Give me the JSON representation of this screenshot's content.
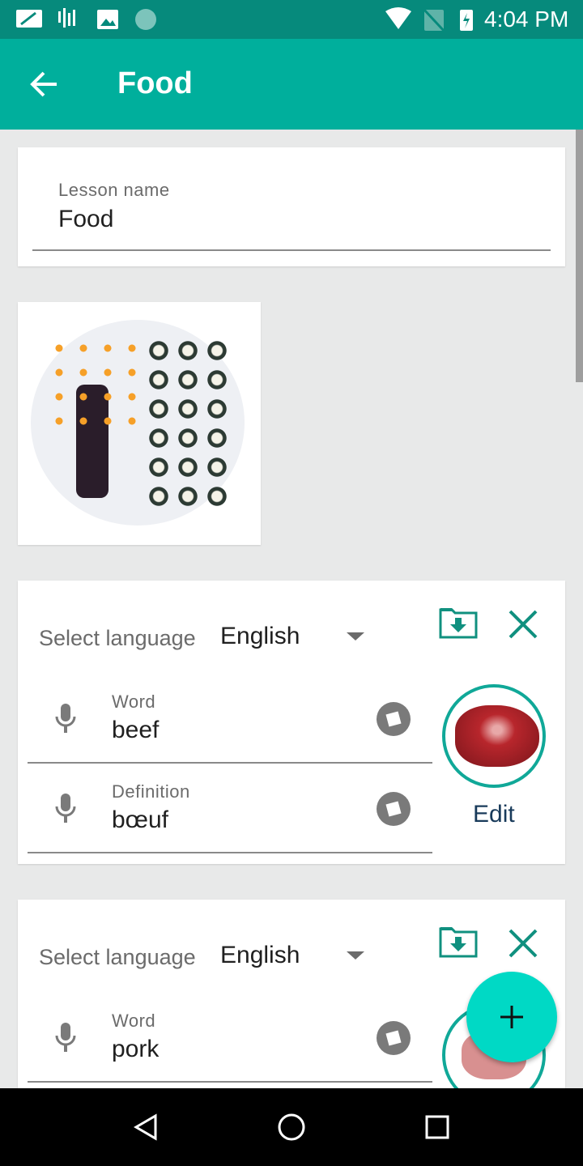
{
  "status_bar": {
    "time": "4:04 PM",
    "icons": [
      "sim-card-icon",
      "voicemail-icon",
      "image-icon",
      "sync-icon",
      "wifi-icon",
      "no-sim-icon",
      "battery-charging-icon"
    ]
  },
  "toolbar": {
    "title": "Food",
    "back_icon": "arrow-left-icon"
  },
  "lesson": {
    "label": "Lesson name",
    "value": "Food"
  },
  "cards": [
    {
      "select_label": "Select language",
      "language": "English",
      "word_label": "Word",
      "word": "beef",
      "definition_label": "Definition",
      "definition": "bœuf",
      "edit_label": "Edit"
    },
    {
      "select_label": "Select language",
      "language": "English",
      "word_label": "Word",
      "word": "pork"
    }
  ],
  "fab": {
    "icon": "plus-icon"
  },
  "colors": {
    "primary": "#00af9c",
    "status_bar": "#068a7c",
    "accent": "#00d9c5",
    "icon_teal": "#10907f"
  }
}
